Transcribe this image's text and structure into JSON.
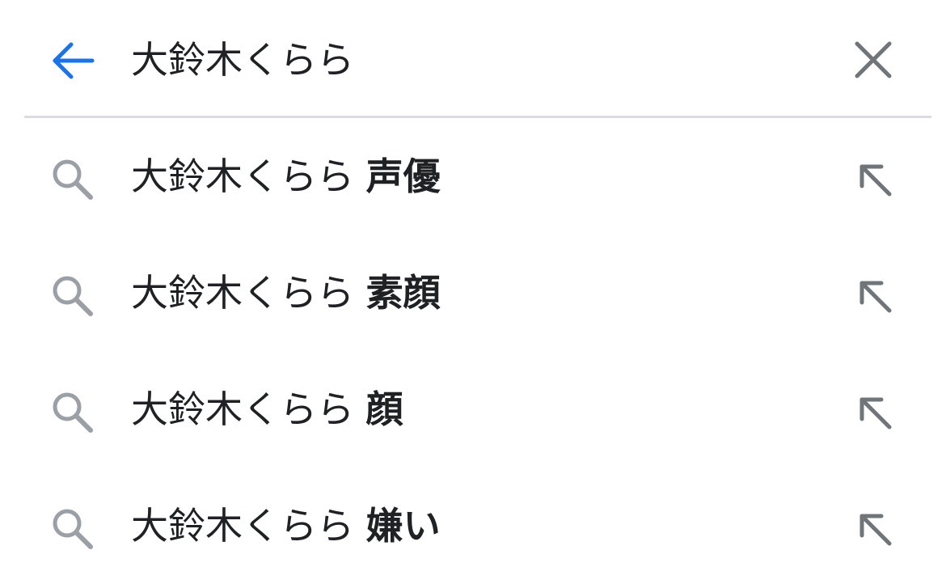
{
  "search": {
    "query": "大鈴木くらら",
    "back_icon": "arrow-left-icon",
    "clear_icon": "close-icon",
    "accent_color": "#1a73e8",
    "icon_color": "#70757a"
  },
  "suggestions": [
    {
      "base": "大鈴木くらら ",
      "completion": "声優",
      "icon": "search-icon",
      "action_icon": "arrow-up-left-icon"
    },
    {
      "base": "大鈴木くらら ",
      "completion": "素顔",
      "icon": "search-icon",
      "action_icon": "arrow-up-left-icon"
    },
    {
      "base": "大鈴木くらら ",
      "completion": "顔",
      "icon": "search-icon",
      "action_icon": "arrow-up-left-icon"
    },
    {
      "base": "大鈴木くらら ",
      "completion": "嫌い",
      "icon": "search-icon",
      "action_icon": "arrow-up-left-icon"
    }
  ]
}
